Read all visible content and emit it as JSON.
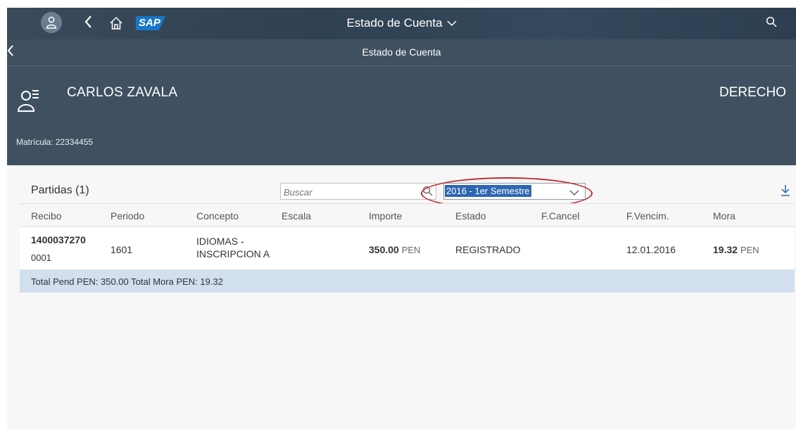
{
  "shell": {
    "title": "Estado de Cuenta",
    "logo_text": "SAP"
  },
  "subheader": {
    "title": "Estado de Cuenta"
  },
  "object_header": {
    "name": "CARLOS ZAVALA",
    "status": "DERECHO",
    "matricula_label": "Matrícula:",
    "matricula_value": "22334455"
  },
  "table": {
    "title": "Partidas (1)",
    "search_placeholder": "Buscar",
    "period_select": "2016 - 1er Semestre",
    "columns": [
      "Recibo",
      "Periodo",
      "Concepto",
      "Escala",
      "Importe",
      "Estado",
      "F.Cancel",
      "F.Vencim.",
      "Mora"
    ],
    "rows": [
      {
        "recibo_num": "1400037270",
        "recibo_sub": "0001",
        "periodo": "1601",
        "concepto_line1": "IDIOMAS -",
        "concepto_line2": "INSCRIPCION A",
        "escala": "",
        "importe_amount": "350.00",
        "importe_currency": "PEN",
        "estado": "REGISTRADO",
        "f_cancel": "",
        "f_vencim": "12.01.2016",
        "mora_amount": "19.32",
        "mora_currency": "PEN"
      }
    ],
    "total_text": "Total Pend PEN: 350.00 Total Mora PEN: 19.32"
  },
  "icons": {
    "avatar": "person-icon",
    "back": "chevron-left-icon",
    "home": "home-icon",
    "title_dropdown": "chevron-down-icon",
    "search": "search-icon",
    "object": "person-list-icon",
    "download": "download-icon"
  },
  "colors": {
    "shell_bar": "#2f4152",
    "header_bg": "#3f5161",
    "accent_blue": "#2e67b1",
    "total_row": "#d1dfef",
    "annotation_red": "#c0292f"
  }
}
